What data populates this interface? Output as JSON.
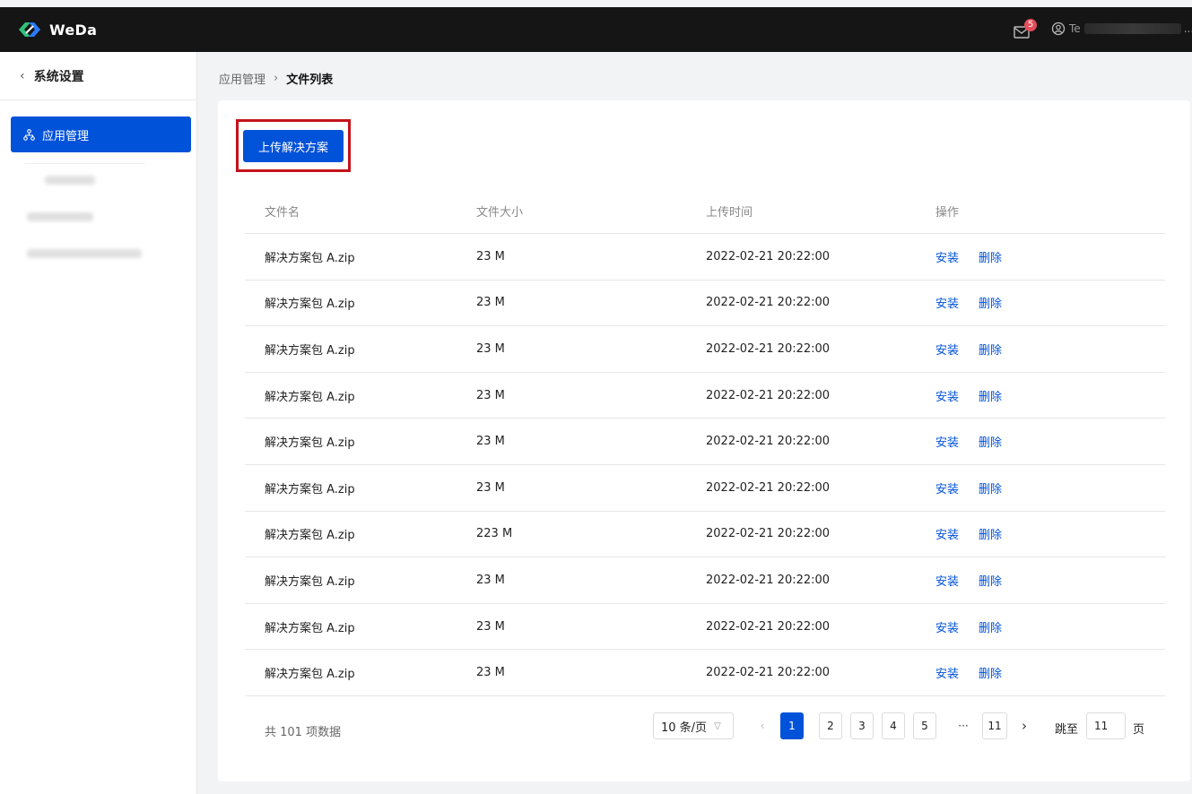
{
  "app": {
    "name": "WeDa",
    "user_prefix": "Te",
    "user_more": "...",
    "mail_count": "5"
  },
  "sidebar": {
    "back_label": "系统设置",
    "active_item": "应用管理"
  },
  "breadcrumb": {
    "parent": "应用管理",
    "current": "文件列表"
  },
  "toolbar": {
    "upload_label": "上传解决方案"
  },
  "table": {
    "headers": {
      "name": "文件名",
      "size": "文件大小",
      "time": "上传时间",
      "op": "操作"
    },
    "rows": [
      {
        "name": "解决方案包 A.zip",
        "size": "23 M",
        "time": "2022-02-21 20:22:00"
      },
      {
        "name": "解决方案包 A.zip",
        "size": "23 M",
        "time": "2022-02-21 20:22:00"
      },
      {
        "name": "解决方案包 A.zip",
        "size": "23 M",
        "time": "2022-02-21 20:22:00"
      },
      {
        "name": "解决方案包 A.zip",
        "size": "23 M",
        "time": "2022-02-21 20:22:00"
      },
      {
        "name": "解决方案包 A.zip",
        "size": "23 M",
        "time": "2022-02-21 20:22:00"
      },
      {
        "name": "解决方案包 A.zip",
        "size": "23 M",
        "time": "2022-02-21 20:22:00"
      },
      {
        "name": "解决方案包 A.zip",
        "size": "223 M",
        "time": "2022-02-21 20:22:00"
      },
      {
        "name": "解决方案包 A.zip",
        "size": "23 M",
        "time": "2022-02-21 20:22:00"
      },
      {
        "name": "解决方案包 A.zip",
        "size": "23 M",
        "time": "2022-02-21 20:22:00"
      },
      {
        "name": "解决方案包 A.zip",
        "size": "23 M",
        "time": "2022-02-21 20:22:00"
      }
    ],
    "install_label": "安装",
    "delete_label": "删除"
  },
  "pagination": {
    "total_label": "共 101 项数据",
    "page_size": "10 条/页",
    "prev": "‹",
    "pages": [
      "1",
      "2",
      "3",
      "4",
      "5"
    ],
    "ellipsis": "···",
    "last_page": "11",
    "next": "›",
    "jump_label": "跳至",
    "jump_value": "11",
    "jump_unit": "页",
    "current_page": 1
  },
  "colors": {
    "primary": "#0052d9",
    "highlight": "#c4121a",
    "badge": "#e34d59",
    "topbar": "#151515"
  }
}
